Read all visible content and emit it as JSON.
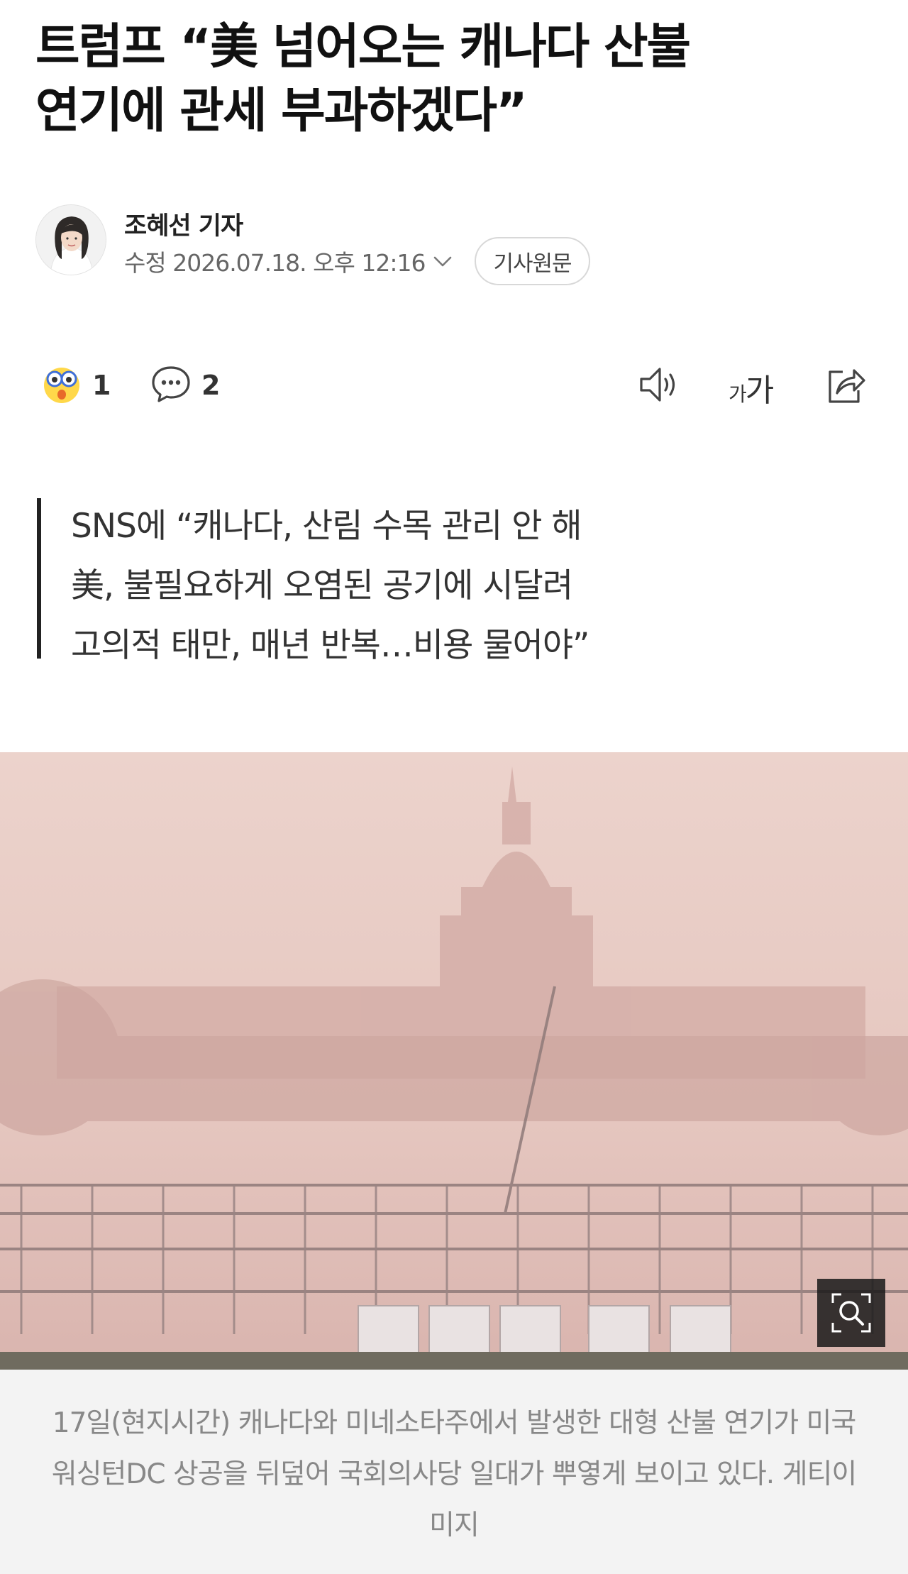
{
  "article": {
    "headline_line1": "트럼프 “美 넘어오는 캐나다 산불",
    "headline_line2": "연기에 관세 부과하겠다”"
  },
  "byline": {
    "reporter": "조혜선 기자",
    "modified": "수정 2026.07.18. 오후 12:16",
    "original_button": "기사원문"
  },
  "actions": {
    "reaction_icon": "surprised-face-icon",
    "reaction_count": "1",
    "comment_icon": "comment-icon",
    "comment_count": "2",
    "tts_icon": "speaker-icon",
    "font_size_label": "가가",
    "share_icon": "share-icon"
  },
  "summary": {
    "lines": [
      "SNS에 “캐나다, 산림 수목 관리 안 해",
      "美, 불필요하게 오염된 공기에 시달려",
      "고의적 태만, 매년 반복…비용 물어야”"
    ]
  },
  "photo": {
    "zoom_icon": "zoom-magnifier-icon",
    "caption": "17일(현지시간) 캐나다와 미네소타주에서 발생한 대형 산불 연기가 미국 워싱턴DC 상공을 뒤덮어 국회의사당 일대가 뿌옇게 보이고 있다. 게티이미지"
  },
  "colors": {
    "text": "#111111",
    "meta": "#666666",
    "caption_bg": "#f3f3f3",
    "haze": "#e7cbc5"
  }
}
